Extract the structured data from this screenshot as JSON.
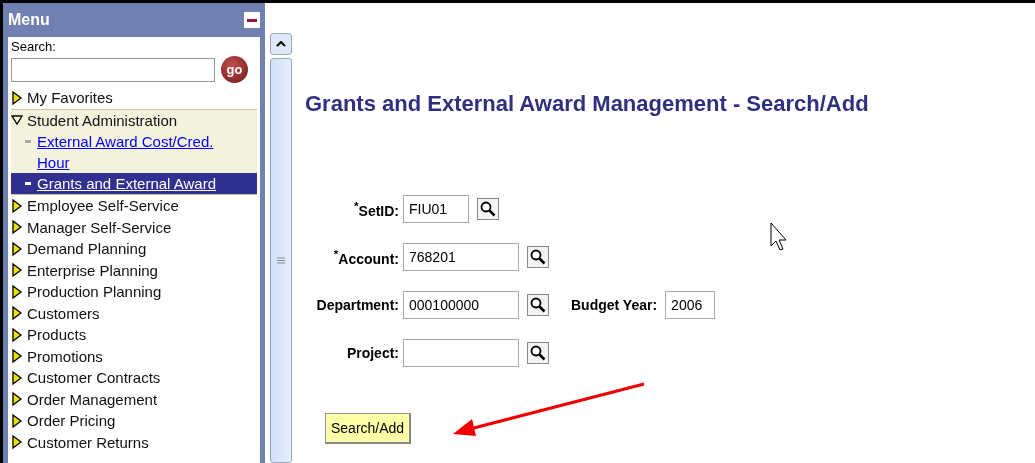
{
  "menu": {
    "title": "Menu",
    "search_label": "Search:",
    "go_button": "go",
    "items": [
      {
        "label": "My Favorites",
        "expanded": false
      },
      {
        "label": "Student Administration",
        "expanded": true,
        "children": [
          {
            "label": "External Award Cost/Cred. Hour",
            "selected": false
          },
          {
            "label": "Grants and External Award",
            "selected": true
          }
        ]
      },
      {
        "label": "Employee Self-Service",
        "expanded": false
      },
      {
        "label": "Manager Self-Service",
        "expanded": false
      },
      {
        "label": "Demand Planning",
        "expanded": false
      },
      {
        "label": "Enterprise Planning",
        "expanded": false
      },
      {
        "label": "Production Planning",
        "expanded": false
      },
      {
        "label": "Customers",
        "expanded": false
      },
      {
        "label": "Products",
        "expanded": false
      },
      {
        "label": "Promotions",
        "expanded": false
      },
      {
        "label": "Customer Contracts",
        "expanded": false
      },
      {
        "label": "Order Management",
        "expanded": false
      },
      {
        "label": "Order Pricing",
        "expanded": false
      },
      {
        "label": "Customer Returns",
        "expanded": false
      }
    ]
  },
  "page_title": "Grants and External Award Management - Search/Add",
  "fields": [
    {
      "label": "$^{*}$SetID:",
      "value": "FIU01",
      "kind": "short"
    },
    {
      "label": "$^{*}$Account:",
      "value": "768201",
      "kind": "long"
    },
    {
      "label": "Department:",
      "value": "000100000",
      "kind": "long",
      "extra": {
        "label": "Budget Year:",
        "value": "2006"
      }
    },
    {
      "label": "Project:",
      "kind": "long"
    }
  ],
  "search_add_button": "Search/Add"
}
